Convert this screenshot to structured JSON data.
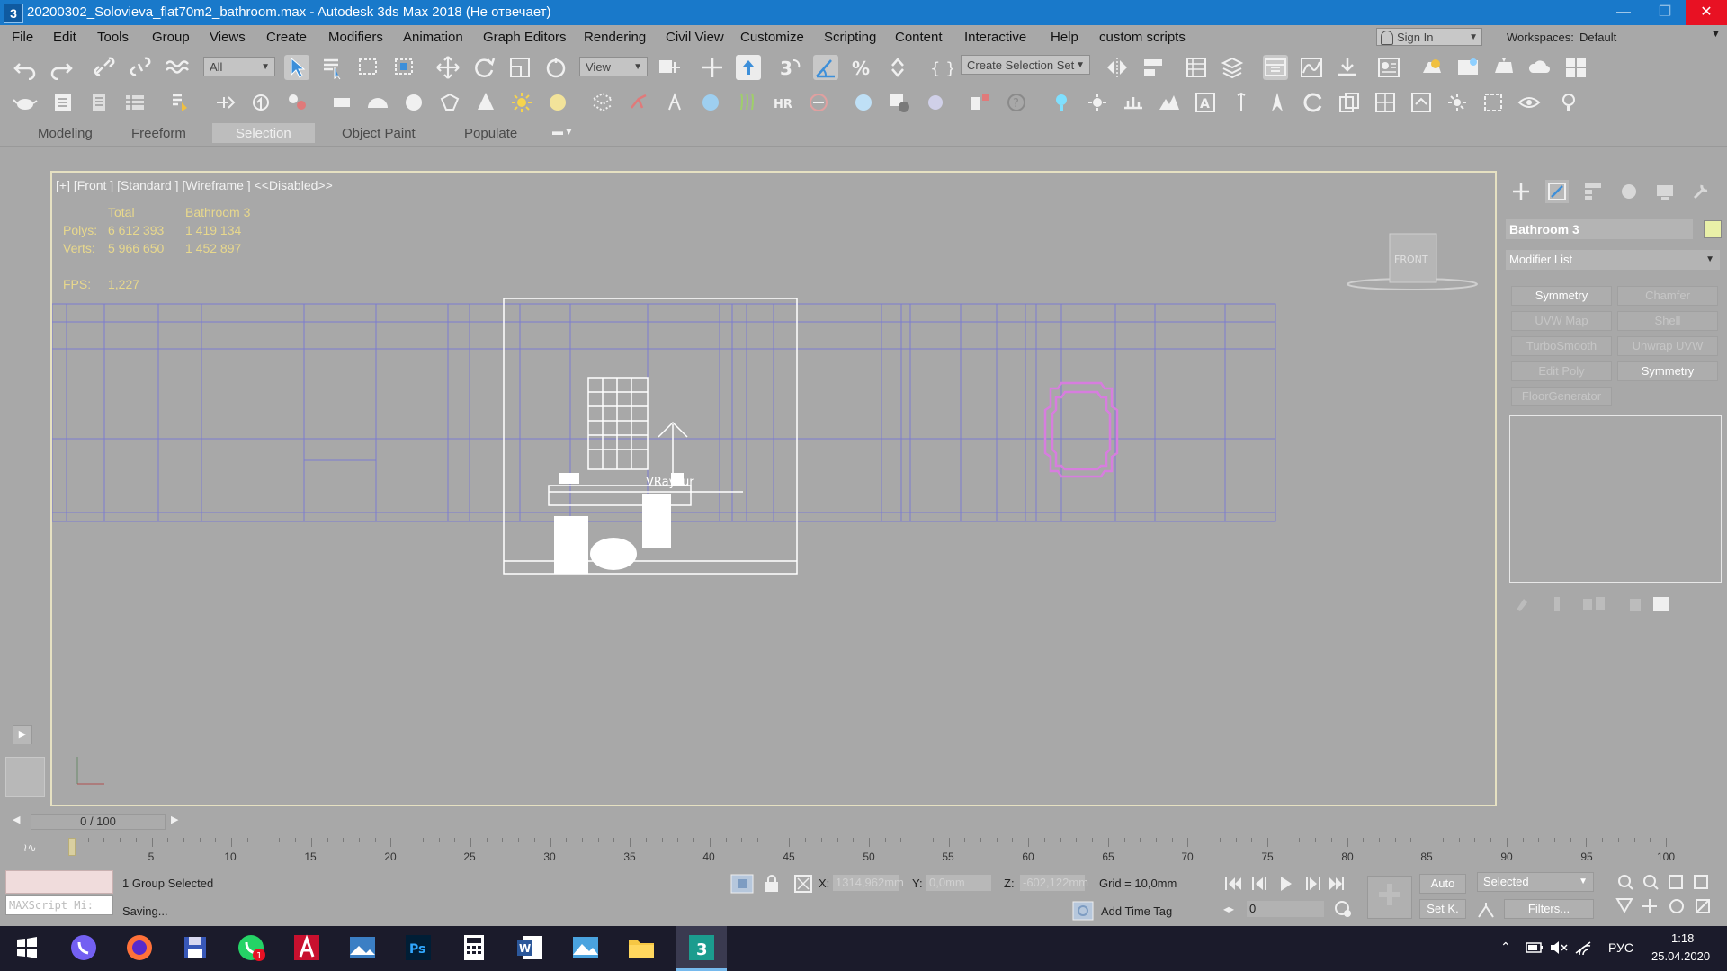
{
  "window": {
    "title": "20200302_Solovieva_flat70m2_bathroom.max - Autodesk 3ds Max 2018  (Не отвечает)",
    "app_icon": "3",
    "minimize": "—",
    "maximize": "❐",
    "close": "✕"
  },
  "menu": {
    "items": [
      "File",
      "Edit",
      "Tools",
      "Group",
      "Views",
      "Create",
      "Modifiers",
      "Animation",
      "Graph Editors",
      "Rendering",
      "Civil View",
      "Customize",
      "Scripting",
      "Content",
      "Interactive",
      "Help",
      "custom scripts"
    ],
    "sign_in": "Sign In",
    "workspaces_label": "Workspaces:",
    "workspaces_value": "Default"
  },
  "toolbar": {
    "filter_value": "All",
    "ref_coord_value": "View",
    "selection_set_placeholder": "Create Selection Set"
  },
  "ribbon": {
    "tabs": [
      "Modeling",
      "Freeform",
      "Selection",
      "Object Paint",
      "Populate"
    ],
    "active_tab": "Selection"
  },
  "viewport": {
    "label": "[+] [Front ] [Standard ] [Wireframe ]  <<Disabled>>",
    "stats": {
      "col_total": "Total",
      "col_object": "Bathroom 3",
      "polys_label": "Polys:",
      "polys_total": "6 612 393",
      "polys_object": "1 419 134",
      "verts_label": "Verts:",
      "verts_total": "5 966 650",
      "verts_object": "1 452 897",
      "fps_label": "FPS:",
      "fps_value": "1,227"
    },
    "viewcube_label": "FRONT",
    "vray_text": "VRayFur"
  },
  "command_panel": {
    "object_name": "Bathroom 3",
    "object_color": "#e9f0a8",
    "modifier_list": "Modifier List",
    "modifier_buttons": [
      {
        "label": "Symmetry",
        "enabled": true
      },
      {
        "label": "Chamfer",
        "enabled": false
      },
      {
        "label": "UVW Map",
        "enabled": false
      },
      {
        "label": "Shell",
        "enabled": false
      },
      {
        "label": "TurboSmooth",
        "enabled": false
      },
      {
        "label": "Unwrap UVW",
        "enabled": false
      },
      {
        "label": "Edit Poly",
        "enabled": false
      },
      {
        "label": "Symmetry",
        "enabled": true
      },
      {
        "label": "FloorGenerator",
        "enabled": false
      }
    ]
  },
  "timeline": {
    "frame_display": "0 / 100",
    "ticks": [
      "5",
      "10",
      "15",
      "20",
      "25",
      "30",
      "35",
      "40",
      "45",
      "50",
      "55",
      "60",
      "65",
      "70",
      "75",
      "80",
      "85",
      "90",
      "95",
      "100"
    ]
  },
  "status": {
    "maxscript_placeholder": "MAXScript Mi:",
    "selection_info": "1 Group Selected",
    "prompt": "Saving...",
    "x_label": "X:",
    "x_value": "1314,962mm",
    "y_label": "Y:",
    "y_value": "0,0mm",
    "z_label": "Z:",
    "z_value": "-602,122mm",
    "grid": "Grid = 10,0mm",
    "add_time_tag": "Add Time Tag",
    "auto_key": "Auto",
    "set_key": "Set K.",
    "key_filter_value": "Selected",
    "filters": "Filters...",
    "current_frame": "0"
  },
  "taskbar": {
    "lang": "РУС",
    "time": "1:18",
    "date": "25.04.2020",
    "whatsapp_badge": "1"
  }
}
